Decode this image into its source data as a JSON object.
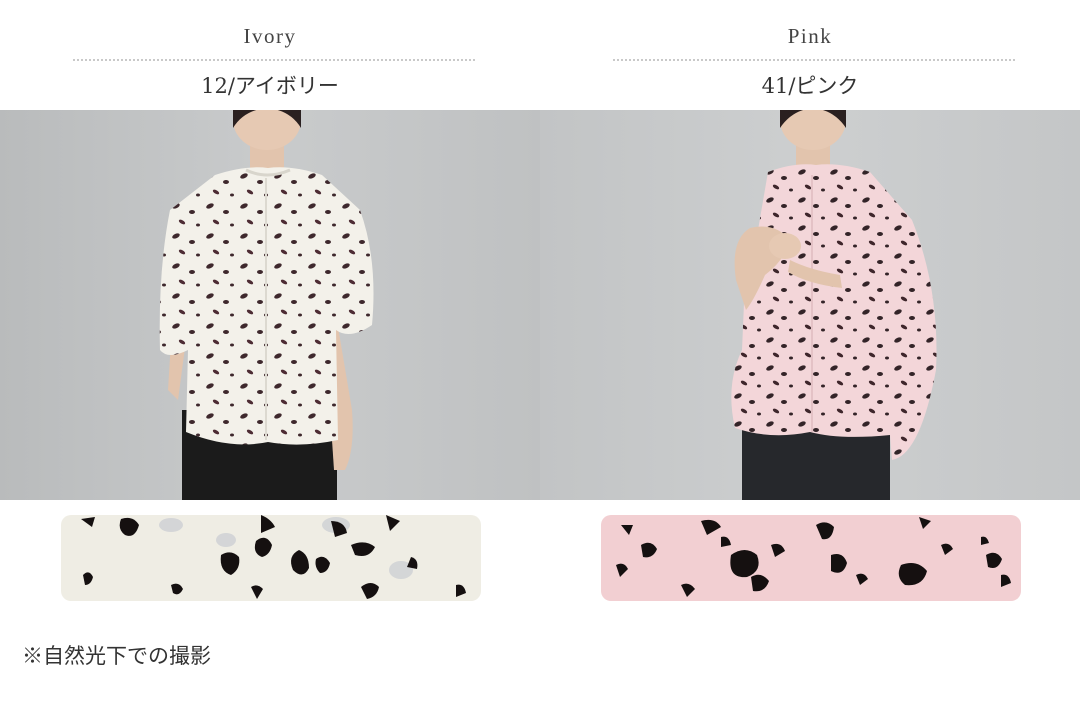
{
  "colors": [
    {
      "name_en": "Ivory",
      "name_jp": "12/アイボリー",
      "shirt_color": "#f3f1ea",
      "swatch_color": "#efede4"
    },
    {
      "name_en": "Pink",
      "name_jp": "41/ピンク",
      "shirt_color": "#f3d6d9",
      "swatch_color": "#f2cfd2"
    }
  ],
  "note": "※自然光下での撮影"
}
